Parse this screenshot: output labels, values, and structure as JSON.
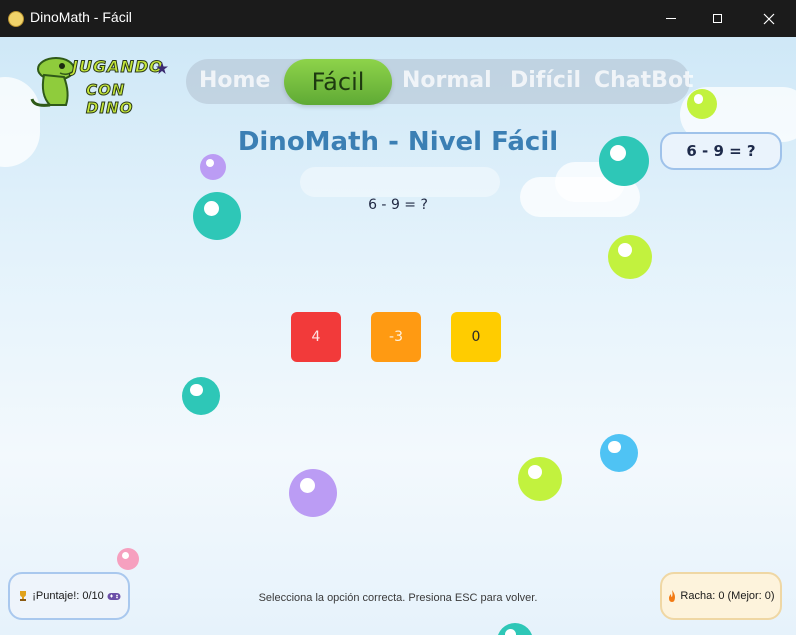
{
  "window": {
    "title": "DinoMath - Fácil"
  },
  "logo": {
    "line1": "JUGANDO",
    "line2": "CON DINO"
  },
  "nav": {
    "items": [
      "Home",
      "Fácil",
      "Normal",
      "Difícil",
      "ChatBot"
    ],
    "active": "Fácil"
  },
  "page": {
    "heading": "DinoMath - Nivel Fácil",
    "question_badge": "6 - 9 = ?",
    "question": "6 - 9 = ?",
    "hint": "Selecciona la opción correcta. Presiona ESC para volver."
  },
  "answers": [
    {
      "label": "4",
      "color": "#f23a3a"
    },
    {
      "label": "-3",
      "color": "#ff9a12"
    },
    {
      "label": "0",
      "color": "#ffcc00"
    }
  ],
  "status": {
    "score_label": "¡Puntaje!: 0/10",
    "streak_label": "Racha: 0 (Mejor: 0)"
  },
  "colors": {
    "heading": "#3b7fb4",
    "nav_active": "#6fbf3e",
    "bubble_teal": "#2ec7b7",
    "bubble_lime": "#c2f23e",
    "bubble_purple": "#bb9cf4",
    "bubble_blue": "#4fc3f4",
    "bubble_pink": "#f6a0bf"
  }
}
